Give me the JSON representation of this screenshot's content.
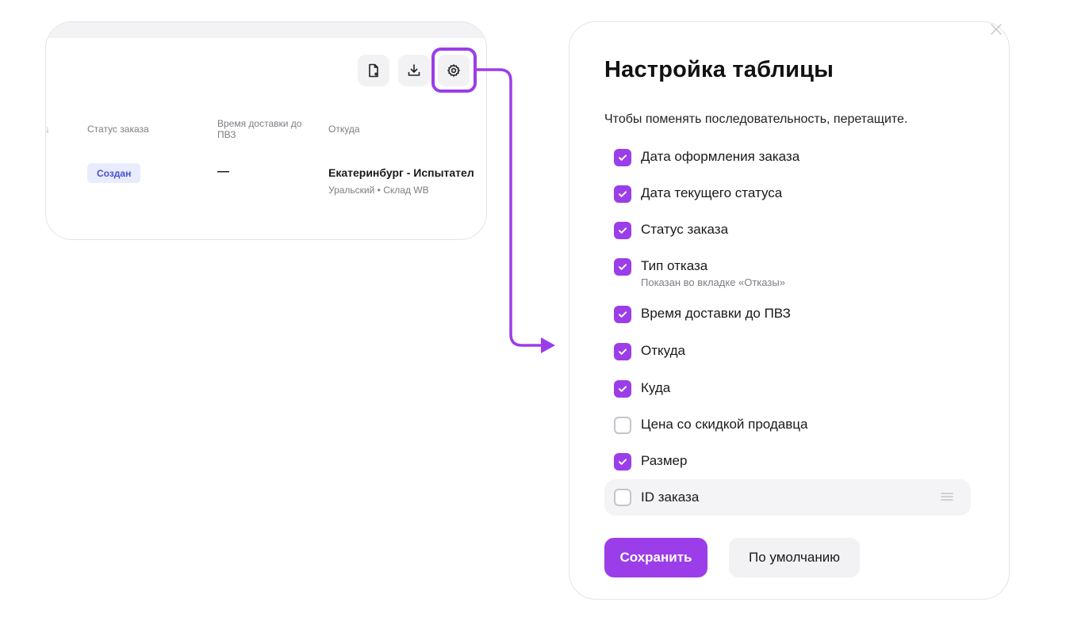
{
  "preview": {
    "columns": {
      "status": "Статус заказа",
      "time": "Время доставки до ПВЗ",
      "from": "Откуда"
    },
    "row": {
      "status": "Создан",
      "time": "—",
      "from_city": "Екатеринбург - Испытател",
      "from_sub": "Уральский • Склад WB"
    },
    "toolbar_icons": [
      "file-export-icon",
      "download-icon",
      "gear-icon"
    ]
  },
  "dialog": {
    "title": "Настройка таблицы",
    "hint": "Чтобы поменять последовательность, перетащите.",
    "options": [
      {
        "label": "Дата оформления заказа",
        "checked": true
      },
      {
        "label": "Дата текущего статуса",
        "checked": true
      },
      {
        "label": "Статус заказа",
        "checked": true
      },
      {
        "label": "Тип отказа",
        "sub": "Показан во вкладке «Отказы»",
        "checked": true
      },
      {
        "label": "Время доставки до ПВЗ",
        "checked": true
      },
      {
        "label": "Откуда",
        "checked": true
      },
      {
        "label": "Куда",
        "checked": true
      },
      {
        "label": "Цена со скидкой продавца",
        "checked": false
      },
      {
        "label": "Размер",
        "checked": true
      },
      {
        "label": "ID заказа",
        "checked": false,
        "hover": true
      }
    ],
    "save_label": "Сохранить",
    "default_label": "По умолчанию"
  },
  "colors": {
    "accent": "#9b3de8",
    "badge_bg": "#e8ecfc",
    "badge_text": "#4a4fd6"
  }
}
